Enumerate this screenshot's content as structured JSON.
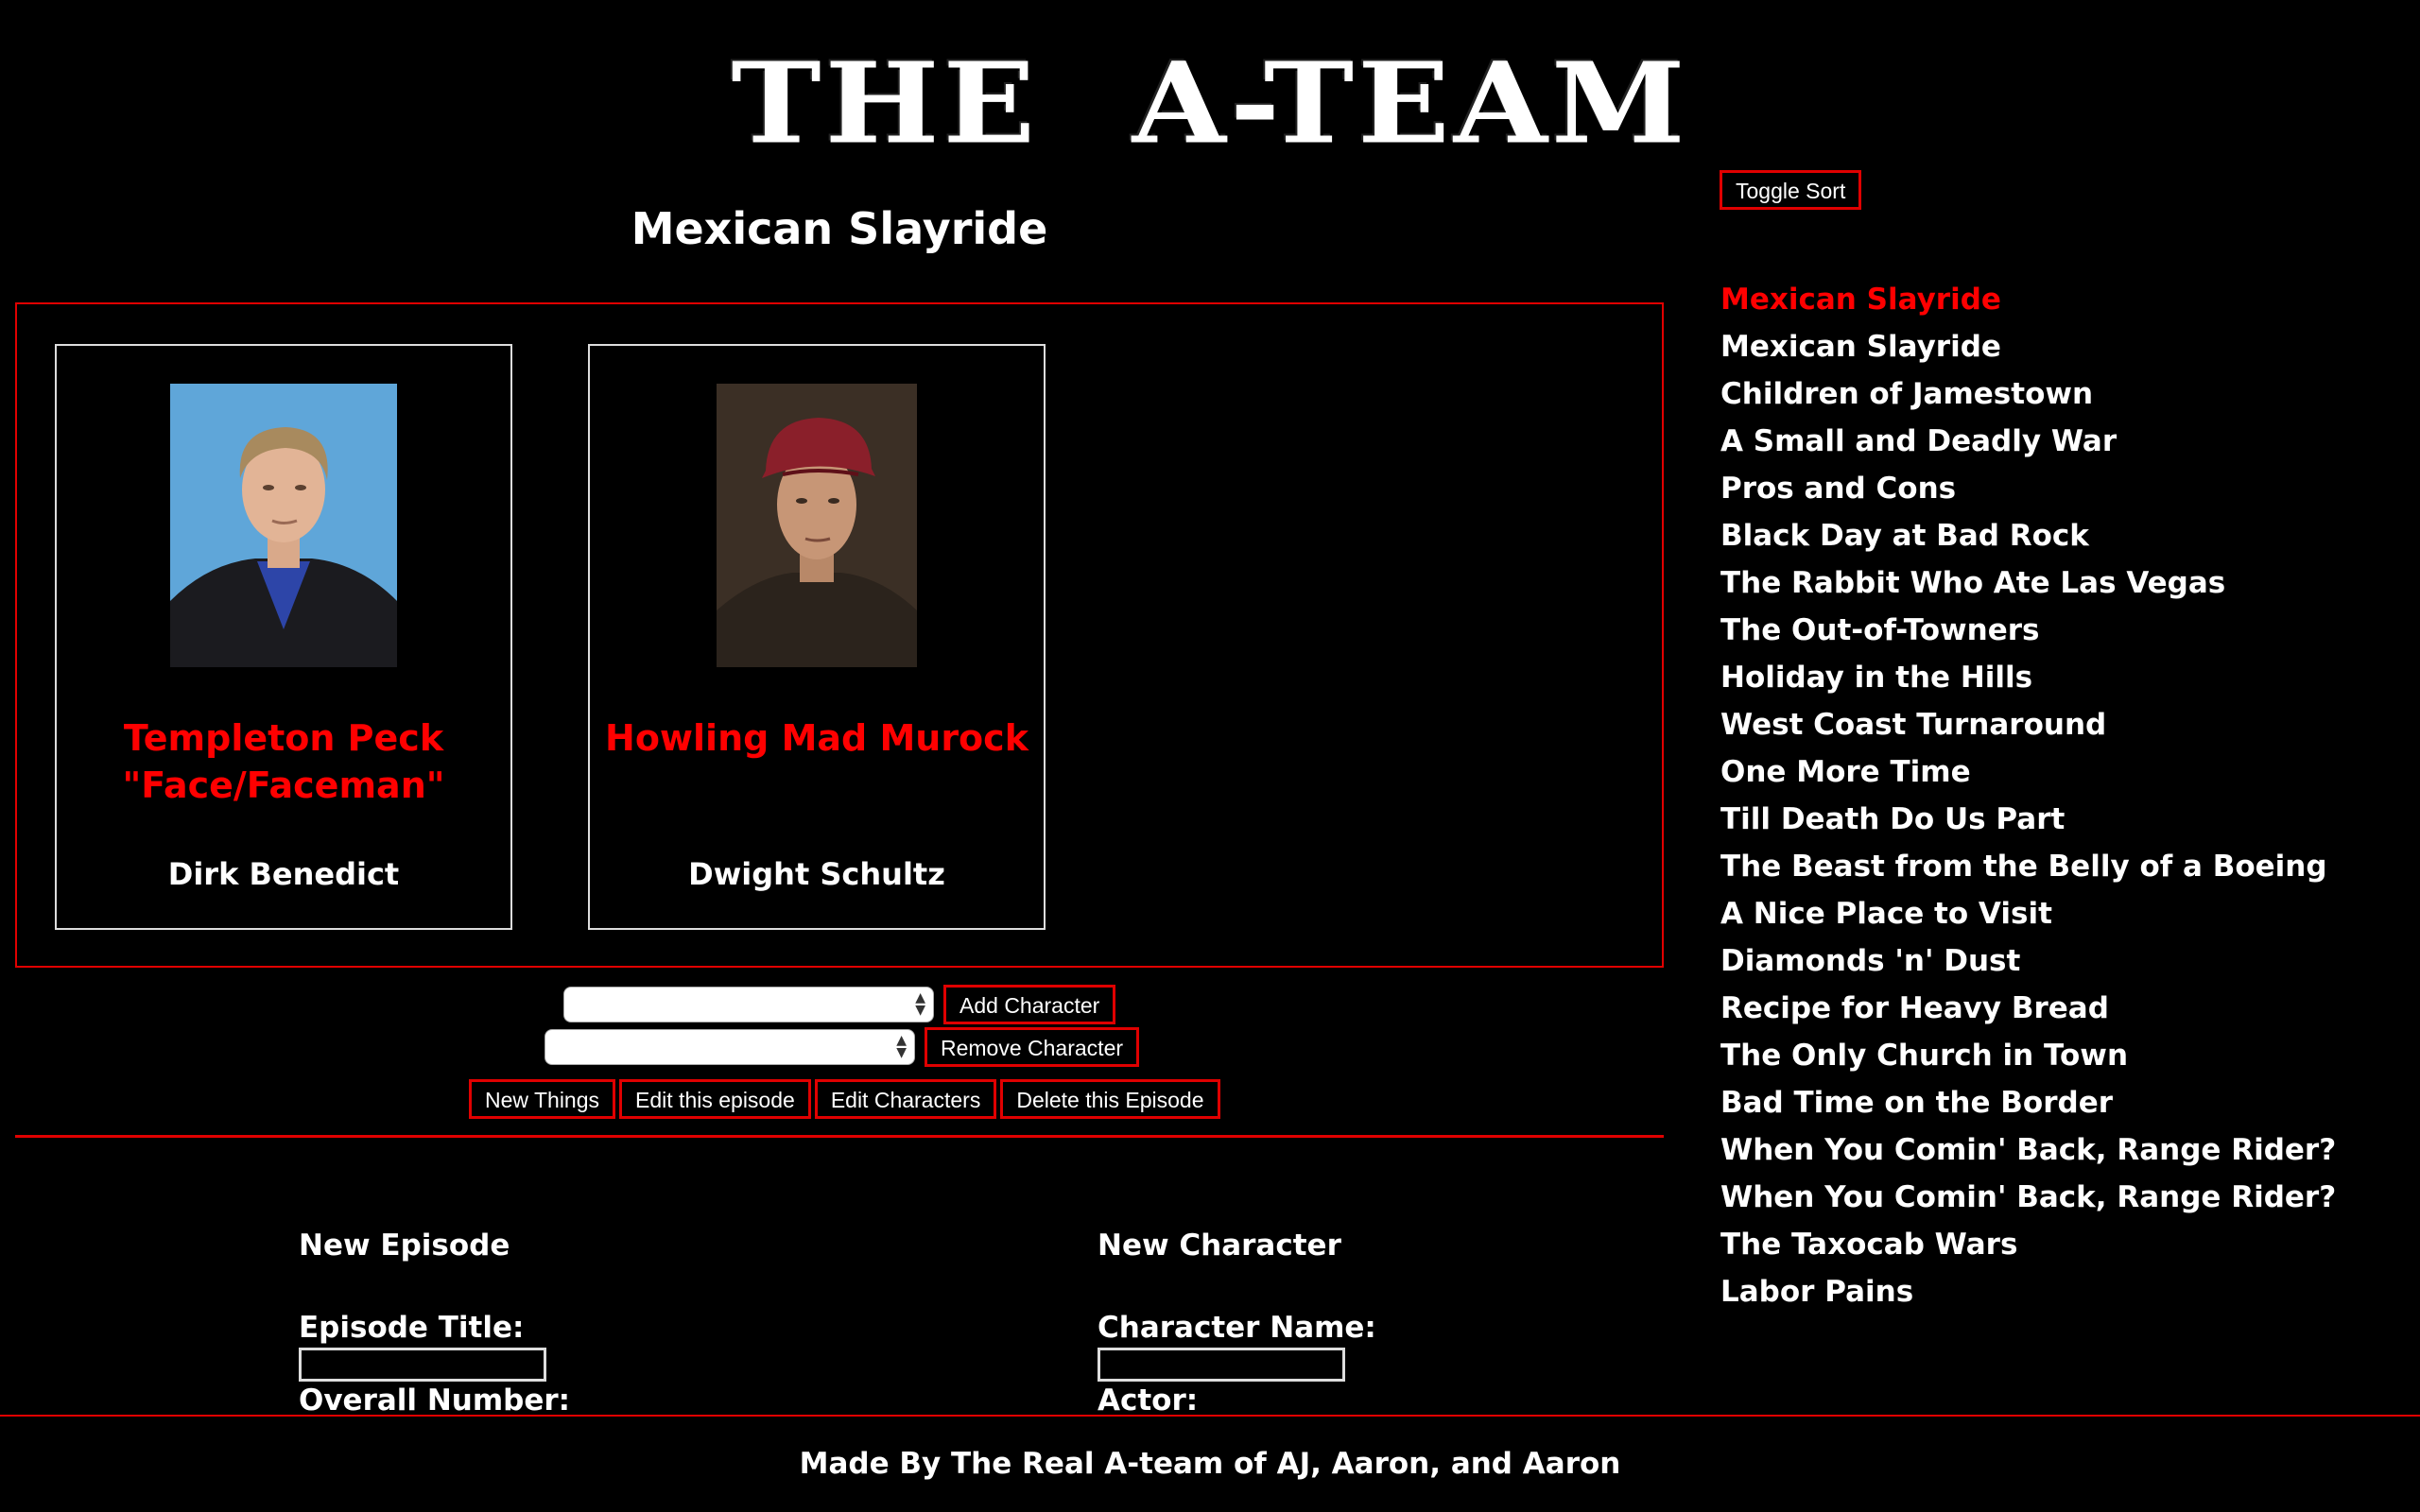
{
  "header": {
    "logo_text": "THE A-TEAM"
  },
  "episode": {
    "title": "Mexican Slayride"
  },
  "cast": [
    {
      "character": "Templeton Peck \"Face/Faceman\"",
      "actor": "Dirk Benedict"
    },
    {
      "character": "Howling Mad Murock",
      "actor": "Dwight Schultz"
    }
  ],
  "controls": {
    "add_character_label": "Add Character",
    "remove_character_label": "Remove Character",
    "new_things_label": "New Things",
    "edit_episode_label": "Edit this episode",
    "edit_characters_label": "Edit Characters",
    "delete_episode_label": "Delete this Episode"
  },
  "forms": {
    "new_episode": {
      "heading": "New Episode",
      "title_label": "Episode Title:",
      "number_label": "Overall Number:"
    },
    "new_character": {
      "heading": "New Character",
      "name_label": "Character Name:",
      "actor_label": "Actor:"
    }
  },
  "sidebar": {
    "toggle_label": "Toggle Sort",
    "episodes": [
      "Mexican Slayride",
      "Mexican Slayride",
      "Children of Jamestown",
      "A Small and Deadly War",
      "Pros and Cons",
      "Black Day at Bad Rock",
      "The Rabbit Who Ate Las Vegas",
      "The Out-of-Towners",
      "Holiday in the Hills",
      "West Coast Turnaround",
      "One More Time",
      "Till Death Do Us Part",
      "The Beast from the Belly of a Boeing",
      "A Nice Place to Visit",
      "Diamonds 'n' Dust",
      "Recipe for Heavy Bread",
      "The Only Church in Town",
      "Bad Time on the Border",
      "When You Comin' Back, Range Rider?",
      "When You Comin' Back, Range Rider?",
      "The Taxocab Wars",
      "Labor Pains"
    ]
  },
  "footer": {
    "text": "Made By The Real A-team of AJ, Aaron, and Aaron"
  },
  "colors": {
    "accent": "#e00000",
    "highlight_text": "#ff0000",
    "background": "#000000"
  }
}
